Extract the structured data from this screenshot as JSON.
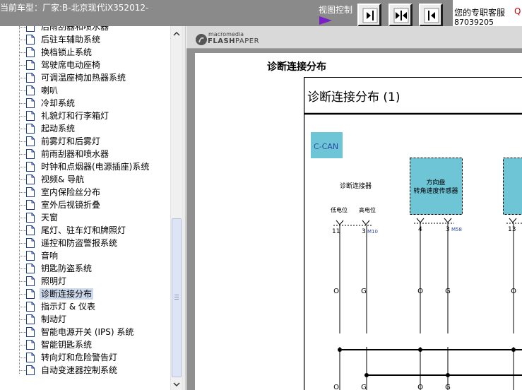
{
  "header": {
    "car_type": "当前车型：厂家:B-北京现代iX352012-",
    "view_control": "视图控制",
    "service_text": "您的专职客服",
    "service_q": "Q",
    "phone": "87039205"
  },
  "tree": {
    "items": [
      {
        "label": "后雨刮器和喷水器"
      },
      {
        "label": "后驻车辅助系统"
      },
      {
        "label": "换档锁止系统"
      },
      {
        "label": "驾驶席电动座椅"
      },
      {
        "label": "可调温座椅加热器系统"
      },
      {
        "label": "喇叭"
      },
      {
        "label": "冷却系统"
      },
      {
        "label": "礼貌灯和行李箱灯"
      },
      {
        "label": "起动系统"
      },
      {
        "label": "前雾灯和后雾灯"
      },
      {
        "label": "前雨刮器和喷水器"
      },
      {
        "label": "时钟和点烟器(电源插座)系统"
      },
      {
        "label": "视频& 导航"
      },
      {
        "label": "室内保险丝分布"
      },
      {
        "label": "室外后视镜折叠"
      },
      {
        "label": "天窗"
      },
      {
        "label": "尾灯、驻车灯和牌照灯"
      },
      {
        "label": "遥控和防盗警报系统"
      },
      {
        "label": "音响"
      },
      {
        "label": "钥匙防盗系统"
      },
      {
        "label": "照明灯"
      },
      {
        "label": "诊断连接分布",
        "selected": true
      },
      {
        "label": "指示灯 & 仪表"
      },
      {
        "label": "制动灯"
      },
      {
        "label": "智能电源开关 (IPS) 系统"
      },
      {
        "label": "智能钥匙系统"
      },
      {
        "label": "转向灯和危险警告灯"
      },
      {
        "label": "自动变速器控制系统"
      }
    ]
  },
  "viewer": {
    "brand_small": "macromedia",
    "brand_flash": "FLASH",
    "brand_paper": "PAPER",
    "doc_title": "诊断连接分布",
    "diagram": {
      "title": "诊断连接分布 (1)",
      "can_label": "C-CAN",
      "dlc_label": "诊断连接器",
      "low_label": "低电位",
      "high_label": "高电位",
      "sensor_label_1": "方向盘",
      "sensor_label_2": "转角速度传感器",
      "pin_11": "11",
      "pin_3a": "3",
      "conn_m10": "M10",
      "pin_4": "4",
      "pin_3b": "3",
      "conn_m58": "M58",
      "pin_13": "13",
      "wire_o": "O",
      "wire_g": "G"
    }
  },
  "colors": {
    "header_bg": "#8a8a8a",
    "selection_bg": "#cdd9ec",
    "can_box": "#6ec5d6",
    "connector_code": "#2a4aa8",
    "arrow": "#7a1ec8"
  }
}
